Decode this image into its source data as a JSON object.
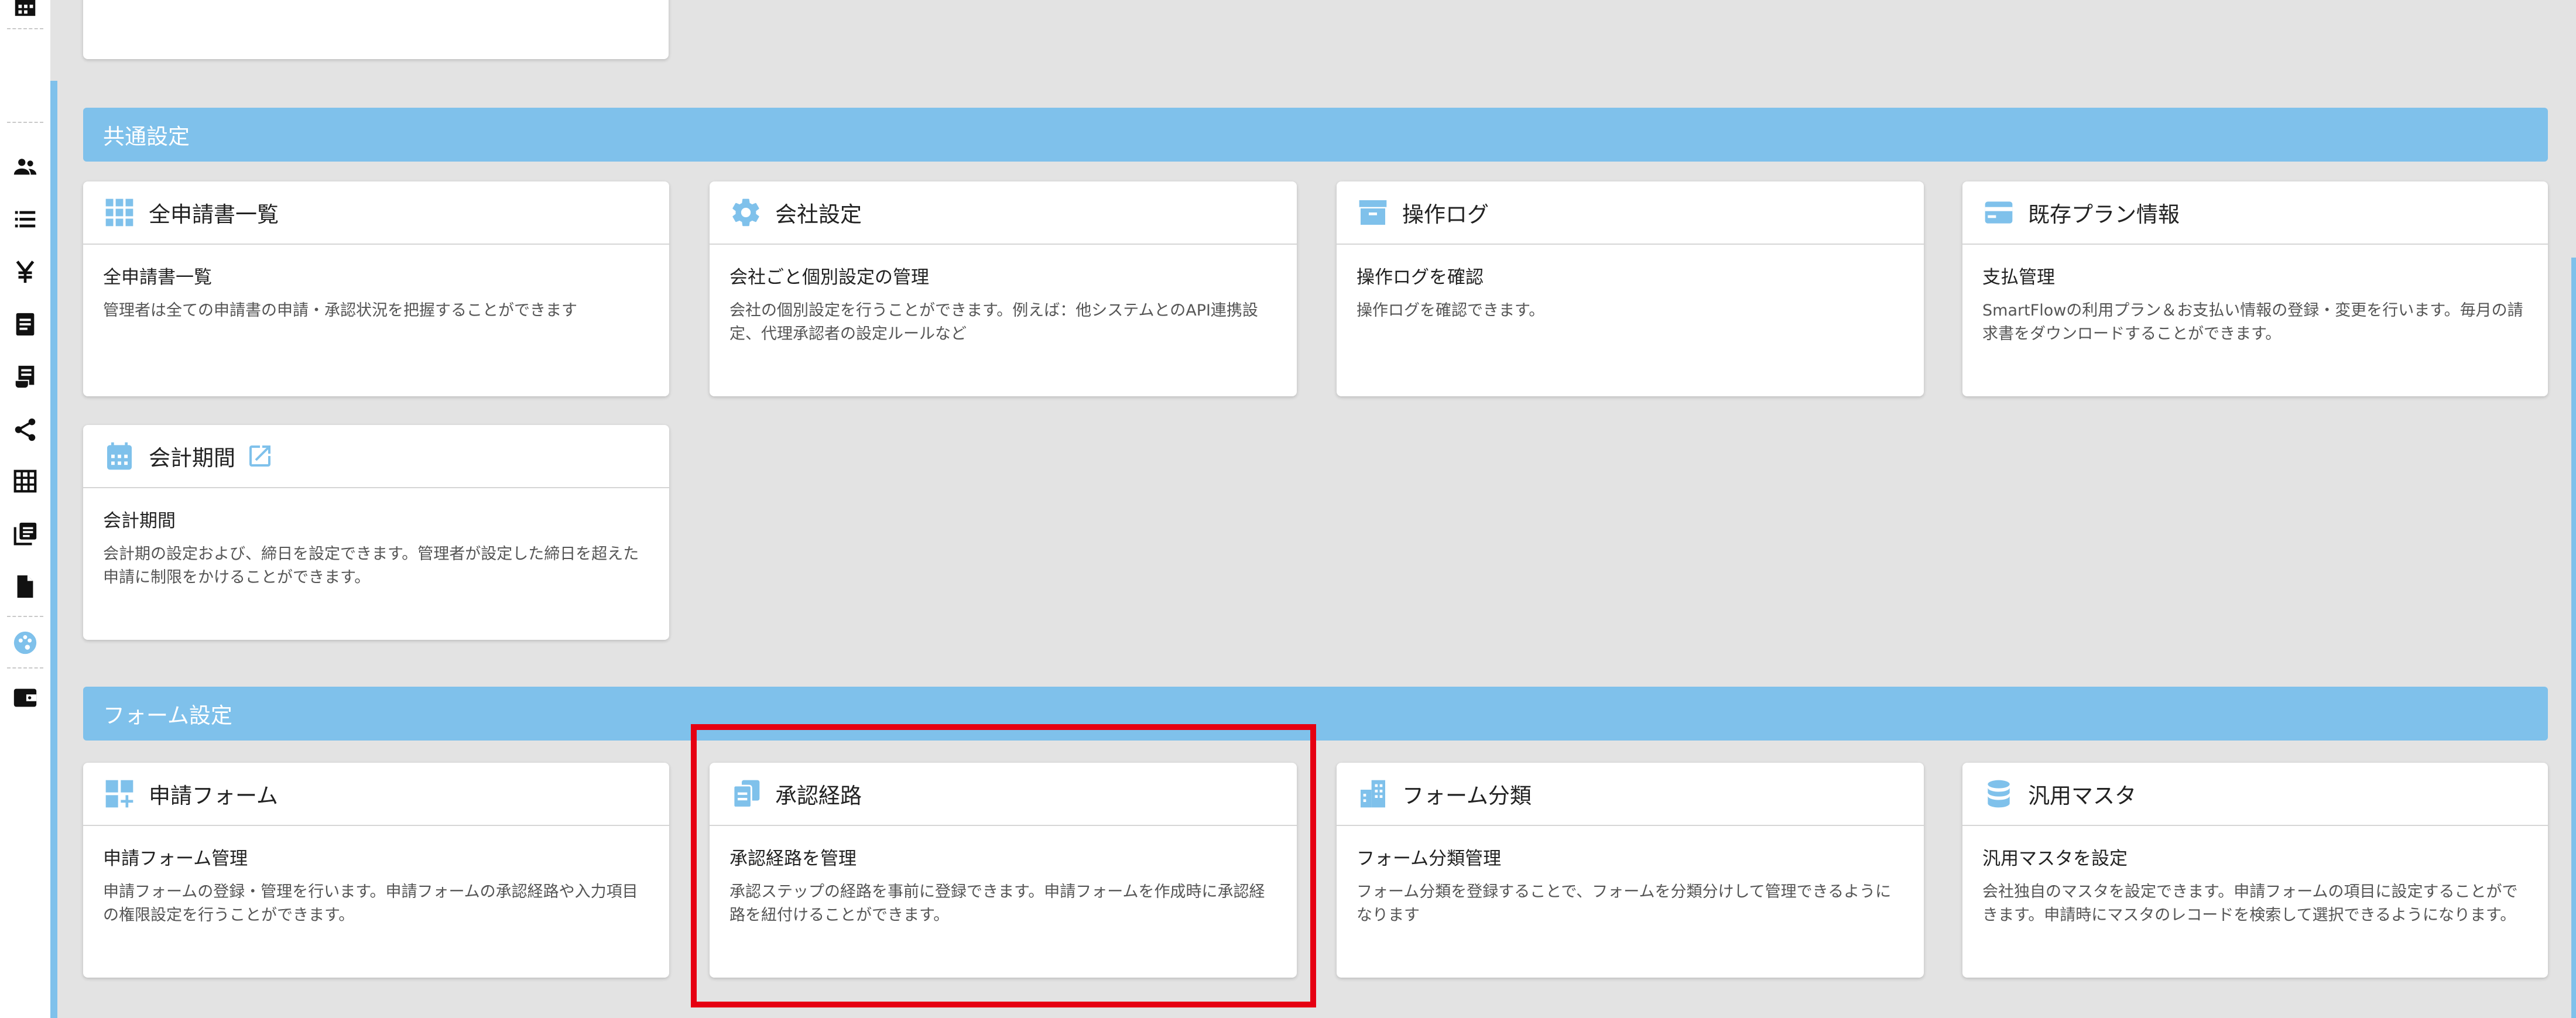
{
  "sections": {
    "common": {
      "title": "共通設定"
    },
    "form": {
      "title": "フォーム設定"
    }
  },
  "cards": {
    "all_applications": {
      "title": "全申請書一覧",
      "subtitle": "全申請書一覧",
      "description": "管理者は全ての申請書の申請・承認状況を把握することができます",
      "icon": "grid-icon"
    },
    "company_settings": {
      "title": "会社設定",
      "subtitle": "会社ごと個別設定の管理",
      "description": "会社の個別設定を行うことができます。例えば：他システムとのAPI連携設定、代理承認者の設定ルールなど",
      "icon": "gear-icon"
    },
    "operation_log": {
      "title": "操作ログ",
      "subtitle": "操作ログを確認",
      "description": "操作ログを確認できます。",
      "icon": "archive-icon"
    },
    "plan_info": {
      "title": "既存プラン情報",
      "subtitle": "支払管理",
      "description": "SmartFlowの利用プラン＆お支払い情報の登録・変更を行います。毎月の請求書をダウンロードすることができます。",
      "icon": "credit-card-icon"
    },
    "fiscal_period": {
      "title": "会計期間",
      "subtitle": "会計期間",
      "description": "会計期の設定および、締日を設定できます。管理者が設定した締日を超えた申請に制限をかけることができます。",
      "icon": "calendar-icon"
    },
    "application_form": {
      "title": "申請フォーム",
      "subtitle": "申請フォーム管理",
      "description": "申請フォームの登録・管理を行います。申請フォームの承認経路や入力項目の権限設定を行うことができます。",
      "icon": "widgets-icon"
    },
    "approval_route": {
      "title": "承認経路",
      "subtitle": "承認経路を管理",
      "description": "承認ステップの経路を事前に登録できます。申請フォームを作成時に承認経路を紐付けることができます。",
      "icon": "route-doc-icon"
    },
    "form_category": {
      "title": "フォーム分類",
      "subtitle": "フォーム分類管理",
      "description": "フォーム分類を登録することで、フォームを分類分けして管理できるようになります",
      "icon": "building-icon"
    },
    "general_master": {
      "title": "汎用マスタ",
      "subtitle": "汎用マスタを設定",
      "description": "会社独自のマスタを設定できます。申請フォームの項目に設定することができます。申請時にマスタのレコードを検索して選択できるようになります。",
      "icon": "database-icon"
    }
  },
  "sidebar": {
    "icons": [
      "calculator-icon",
      "people-icon",
      "list-icon",
      "yen-icon",
      "document-icon",
      "receipt-icon",
      "share-icon",
      "table-icon",
      "library-icon",
      "file-icon",
      "palette-icon",
      "wallet-icon"
    ]
  },
  "colors": {
    "accent": "#7fc1eb",
    "highlight": "#e60012",
    "icon": "#7fc1eb"
  }
}
